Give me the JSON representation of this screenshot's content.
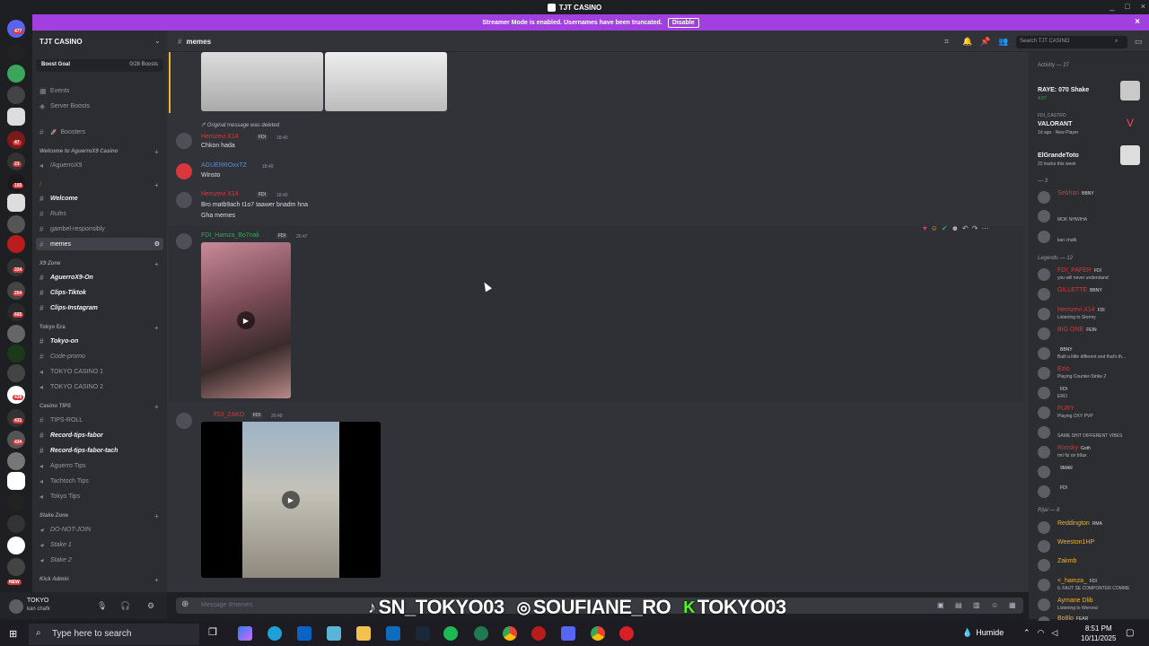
{
  "window": {
    "title": "TJT CASINO",
    "controls": [
      "_",
      "□",
      "×"
    ]
  },
  "banner": {
    "text": "Streamer Mode is enabled. Usernames have been truncated.",
    "button": "Disable",
    "close": "×"
  },
  "rail": {
    "badges": [
      "477",
      "47",
      "23",
      "165",
      "12",
      "324",
      "254",
      "665",
      "438",
      "431",
      "434",
      "NEW"
    ]
  },
  "server": {
    "name": "TJT CASINO",
    "boost_label": "Boost Goal",
    "boost_count": "0/28 Boosts"
  },
  "sidebar": {
    "items": [
      {
        "label": "Events"
      },
      {
        "label": "Server Boosts"
      },
      {
        "label": "Boosters",
        "emoji": "🚀"
      },
      {
        "label": "Welcome to AguerroX9 Casino",
        "category": true
      },
      {
        "label": "/AguerroX9"
      },
      {
        "label": "!",
        "category": true
      },
      {
        "label": "Welcome"
      },
      {
        "label": "Rules"
      },
      {
        "label": "gambel-responsibly"
      },
      {
        "label": "memes"
      },
      {
        "label": "X9 Zone",
        "category": true
      },
      {
        "label": "AguerroX9-On"
      },
      {
        "label": "Clips-Tiktok"
      },
      {
        "label": "Clips-Instagram"
      },
      {
        "label": "Tokyo Era",
        "category": true
      },
      {
        "label": "Tokyo-on"
      },
      {
        "label": "Code-promo"
      },
      {
        "label": "TOKYO CASINO 1"
      },
      {
        "label": "TOKYO CASINO 2"
      },
      {
        "label": "Casino TIPS",
        "category": true
      },
      {
        "label": "TIPS-ROLL"
      },
      {
        "label": "Record-tips-fabor"
      },
      {
        "label": "Record-tips-fabor-tach"
      },
      {
        "label": "Aguerro Tips"
      },
      {
        "label": "Tachtoch Tips"
      },
      {
        "label": "Tokyo Tips"
      },
      {
        "label": "Stake Zone",
        "category": true
      },
      {
        "label": "DO-NOT-JOIN"
      },
      {
        "label": "Stake 1"
      },
      {
        "label": "Stake 2"
      },
      {
        "label": "Kick Admin",
        "category": true
      }
    ]
  },
  "user": {
    "name": "TOKYO",
    "status": "kan chafk"
  },
  "header": {
    "channel": "memes",
    "search_placeholder": "Search TJT CASINO"
  },
  "messages": [
    {
      "deleted_note": "Original message was deleted",
      "user": "Hemzevi X14",
      "tag": "FDI",
      "time": "18:40",
      "text": "Chkon hada"
    },
    {
      "user": "AGUERROxxTZ",
      "time": "18:40",
      "text": "Winsto"
    },
    {
      "user": "Hemzevi X14",
      "tag": "FDI",
      "time": "18:40",
      "text": "Bro matb9ach t1o7 taawer bnadm hna",
      "text2": "Gha memes"
    },
    {
      "user": "FDI_Hamza_Bo7nak",
      "tag": "FDI",
      "time": "20:47"
    },
    {
      "user": "FDI_ZAKO",
      "tag": "FDI",
      "time": "20:49"
    }
  ],
  "composer": {
    "placeholder": "Message #memes"
  },
  "overlay": {
    "tiktok": "SN_TOKYO03",
    "instagram": "SOUFIANE_RO",
    "kick": "TOKYO03"
  },
  "activity": {
    "title": "Activity — 27",
    "items": [
      {
        "name": "RAYE: 070 Shake",
        "sub": "4:07"
      },
      {
        "pre": "FDI_CASTRO",
        "name": "VALORANT",
        "sub": "1d ago · New Player"
      },
      {
        "name": "ElGrandeToto",
        "sub": "22 tracks this week"
      }
    ]
  },
  "members": {
    "groups": [
      {
        "label": "— 3"
      },
      {
        "label": "Legends — 12"
      },
      {
        "label": "Rijal — 8"
      }
    ],
    "rows": [
      {
        "name": "Sebhan",
        "tag": "BBNY",
        "sub": "",
        "color": "#d13a3a"
      },
      {
        "name": "",
        "tag": "",
        "sub": "MOK NHWIHA",
        "color": "#d13a3a"
      },
      {
        "name": "",
        "tag": "",
        "sub": "kan chafk",
        "color": "#d13a3a"
      },
      {
        "name": "FDI_PAFER",
        "tag": "FDI",
        "sub": "you will never understand",
        "color": "#d13a3a"
      },
      {
        "name": "GILLETTE",
        "tag": "BBNY",
        "sub": "",
        "color": "#d13a3a"
      },
      {
        "name": "Hemzevi X14",
        "tag": "FDI",
        "sub": "Listening to Stormy",
        "color": "#d13a3a"
      },
      {
        "name": "BIG ONE",
        "tag": "FEIN",
        "sub": "",
        "color": "#d13a3a"
      },
      {
        "name": "",
        "tag": "BBNY",
        "sub": "Built a little different and that's th...",
        "color": "#d13a3a"
      },
      {
        "name": "Ezio",
        "tag": "",
        "sub": "Playing Counter-Strike 2",
        "color": "#d13a3a"
      },
      {
        "name": "",
        "tag": "FDI",
        "sub": "ERO",
        "color": "#d13a3a"
      },
      {
        "name": "FURY",
        "tag": "",
        "sub": "Playing OXY PVP",
        "color": "#d13a3a"
      },
      {
        "name": "",
        "tag": "",
        "sub": "SAME SHIT DIFFERENT VIBES",
        "color": "#d13a3a"
      },
      {
        "name": "Rimsky",
        "tag": "Goth",
        "sub": "mri fiz on b9ax",
        "color": "#d13a3a"
      },
      {
        "name": "",
        "tag": "9MAR",
        "sub": "",
        "color": "#d13a3a"
      },
      {
        "name": "",
        "tag": "FDI",
        "sub": "",
        "color": "#d13a3a"
      },
      {
        "name": "Reddington",
        "tag": "RMA",
        "sub": "",
        "color": "#f0b232"
      },
      {
        "name": "Weeston1HP",
        "tag": "",
        "sub": "",
        "color": "#f0b232"
      },
      {
        "name": "Zakmb",
        "tag": "",
        "sub": "",
        "color": "#f0b232"
      },
      {
        "name": "<_hamza_",
        "tag": "FDI",
        "sub": "IL FAUT SE COMPORTER COMME",
        "color": "#f0b232"
      },
      {
        "name": "Aymane Dlib",
        "tag": "",
        "sub": "Listening to Weronci",
        "color": "#f0b232"
      },
      {
        "name": "Bo8lo",
        "tag": "FEAR",
        "sub": "",
        "color": "#f0b232"
      }
    ]
  },
  "taskbar": {
    "search_placeholder": "Type here to search",
    "weather": "Humide",
    "time": "8:51 PM",
    "date": "10/11/2025"
  },
  "colors": {
    "accent": "#a23fe0",
    "main_bg": "#313338",
    "sidebar_bg": "#2b2d31"
  }
}
